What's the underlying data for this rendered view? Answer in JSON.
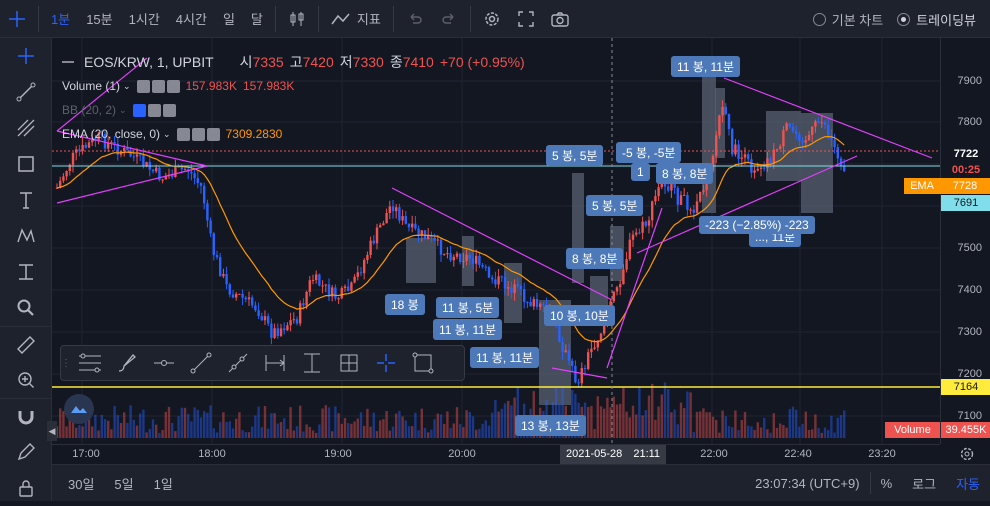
{
  "toolbar": {
    "intervals": [
      "1분",
      "15분",
      "1시간",
      "4시간",
      "일",
      "달"
    ],
    "active_interval": "1분",
    "indicator_label": "지표",
    "chart_types": [
      "기본 차트",
      "트레이딩뷰"
    ],
    "selected_chart_type": "트레이딩뷰"
  },
  "symbol": {
    "title": "EOS/KRW, 1, UPBIT",
    "open_label": "시",
    "open": "7335",
    "high_label": "고",
    "high": "7420",
    "low_label": "저",
    "low": "7330",
    "close_label": "종",
    "close": "7410",
    "change": "+70 (+0.95%)"
  },
  "legends": {
    "volume": {
      "name": "Volume (1)",
      "v1": "157.983K",
      "v2": "157.983K"
    },
    "bb": {
      "name": "BB (20, 2)"
    },
    "ema": {
      "name": "EMA (20, close, 0)",
      "value": "7309.2830"
    }
  },
  "price_axis": {
    "ticks": [
      "7900",
      "7800",
      "7722",
      "7500",
      "7400",
      "7300",
      "7200",
      "7100"
    ],
    "last_price": "7722",
    "countdown": "00:25",
    "ema_tag": "EMA",
    "ema_value": "7728",
    "level_7691": "7691",
    "level_7164": "7164",
    "volume_tag": "Volume",
    "volume_value": "39.455K"
  },
  "time_axis": {
    "ticks": [
      "17:00",
      "18:00",
      "19:00",
      "20:00",
      "22:00",
      "22:40",
      "23:20"
    ],
    "cursor_date": "2021-05-28",
    "cursor_time": "21:11"
  },
  "annotations": [
    "11 봉, 11분",
    "5 봉, 5분",
    "-5 봉, -5분",
    "8 봉, 8분",
    "5 봉, 5분",
    "-223 (−2.85%) -223",
    "8 봉, 8분",
    "18 봉",
    "11 봉, 5분",
    "11 봉, 11분",
    "10 봉, 10분",
    "11 봉, 11분",
    "13 봉, 13분",
    "1",
    "..., 11분"
  ],
  "bottombar": {
    "ranges": [
      "30일",
      "5일",
      "1일"
    ],
    "clock": "23:07:34 (UTC+9)",
    "percent": "%",
    "log": "로그",
    "auto": "자동"
  },
  "colors": {
    "up": "#ef5350",
    "down": "#2962ff",
    "magenta": "#e040fb",
    "yellow": "#ffeb3b",
    "ema": "#ff9800",
    "accent": "#2962ff"
  },
  "icons": [
    "crosshair-icon",
    "trend-line-icon",
    "fib-icon",
    "rectangle-icon",
    "text-icon",
    "pattern-icon",
    "measure-icon",
    "zoom-icon",
    "ruler-icon",
    "zoom-in-icon",
    "magnet-icon",
    "lock-icon",
    "settings-icon",
    "camera-icon",
    "fullscreen-icon",
    "undo-icon",
    "redo-icon",
    "candles-icon"
  ]
}
